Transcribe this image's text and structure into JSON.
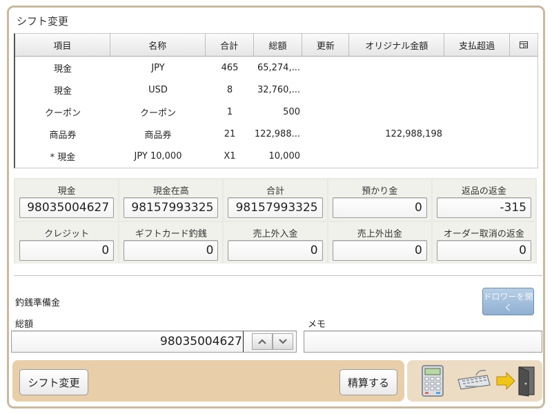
{
  "window": {
    "title": "シフト変更"
  },
  "grid": {
    "columns": [
      "項目",
      "名称",
      "合計",
      "総額",
      "更新",
      "オリジナル金額",
      "支払超過",
      ""
    ],
    "rows": [
      [
        "現金",
        "JPY",
        "465",
        "65,274,...",
        "",
        "",
        ""
      ],
      [
        "現金",
        "USD",
        "8",
        "32,760,...",
        "",
        "",
        ""
      ],
      [
        "クーポン",
        "クーポン",
        "1",
        "500",
        "",
        "",
        ""
      ],
      [
        "商品券",
        "商品券",
        "21",
        "122,988...",
        "",
        "122,988,198",
        ""
      ],
      [
        "* 現金",
        "JPY 10,000",
        "X1",
        "10,000",
        "",
        "",
        ""
      ]
    ],
    "column_menu_icon": "table-columns-icon"
  },
  "summary": {
    "cells": [
      {
        "label": "現金",
        "value": "98035004627"
      },
      {
        "label": "現金在高",
        "value": "98157993325"
      },
      {
        "label": "合計",
        "value": "98157993325"
      },
      {
        "label": "預かり金",
        "value": "0"
      },
      {
        "label": "返品の返金",
        "value": "-315"
      },
      {
        "label": "クレジット",
        "value": "0"
      },
      {
        "label": "ギフトカード釣銭",
        "value": "0"
      },
      {
        "label": "売上外入金",
        "value": "0"
      },
      {
        "label": "売上外出金",
        "value": "0"
      },
      {
        "label": "オーダー取消の返金",
        "value": "0"
      }
    ]
  },
  "float": {
    "section_label": "釣銭準備金",
    "amount_label": "総額",
    "amount_value": "98035004627",
    "memo_label": "メモ",
    "memo_value": "",
    "open_drawer_label": "ドロワーを開く"
  },
  "footer": {
    "shift_change_label": "シフト変更",
    "settle_label": "精算する",
    "icons": [
      "calculator-icon",
      "keyboard-icon",
      "exit-door-icon"
    ]
  },
  "colors": {
    "frame": "#c9b99f",
    "footer_left": "#e8cfa9",
    "footer_right": "#eddcc4",
    "drawer_button": "#9fbcd9"
  }
}
